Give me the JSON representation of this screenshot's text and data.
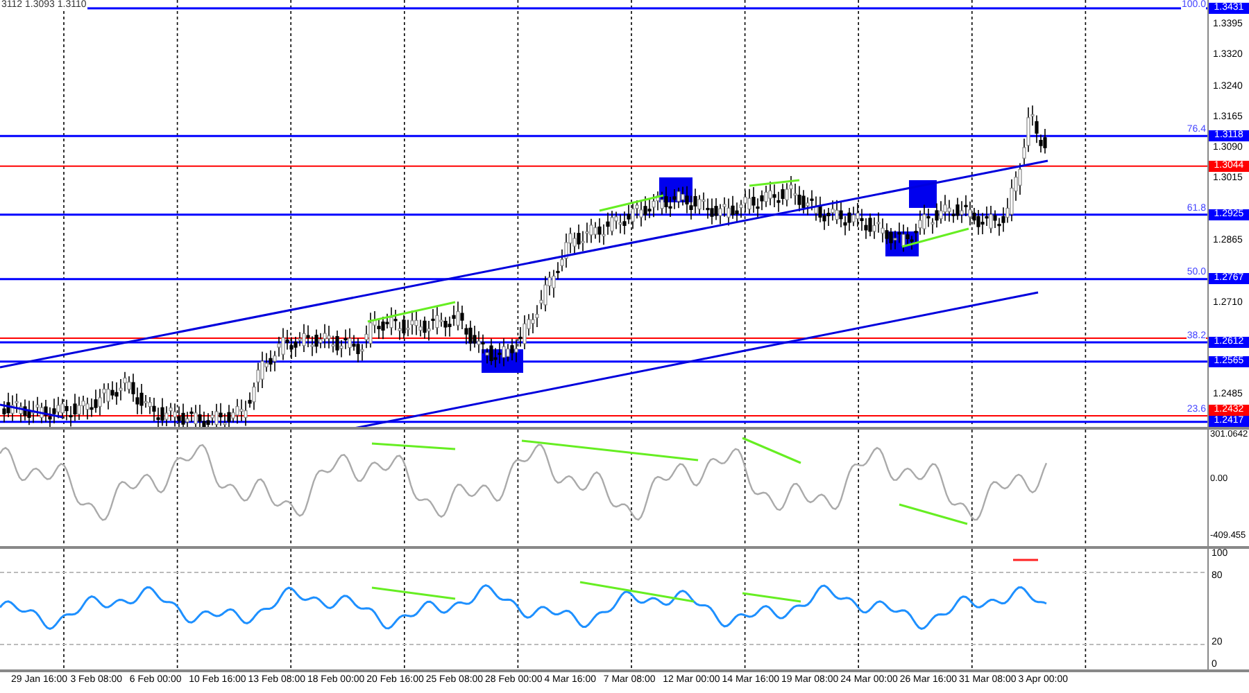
{
  "header": {
    "text": "3112 1.3093 1.3110"
  },
  "price_panel": {
    "axis_ticks": [
      "1.3395",
      "1.3320",
      "1.3240",
      "1.3165",
      "1.3090",
      "1.3015",
      "1.2865",
      "1.2710",
      "1.2485"
    ],
    "levels": [
      {
        "price": "1.3431",
        "color": "#0000ff",
        "fib": "100.0"
      },
      {
        "price": "1.3118",
        "color": "#0000ff",
        "fib": "76.4"
      },
      {
        "price": "1.3044",
        "color": "#ff0000"
      },
      {
        "price": "1.2925",
        "color": "#0000ff",
        "fib": "61.8"
      },
      {
        "price": "1.2767",
        "color": "#0000ff",
        "fib": "50.0"
      },
      {
        "price": "1.2612",
        "color": "#0000ff",
        "fib": "38.2"
      },
      {
        "price": "1.2565",
        "color": "#0000ff"
      },
      {
        "price": "1.2432",
        "color": "#ff0000",
        "fib": "23.6"
      },
      {
        "price": "1.2417",
        "color": "#0000ff"
      }
    ]
  },
  "cci_panel": {
    "axis_ticks": [
      "301.0642",
      "0.00",
      "-409.455"
    ]
  },
  "rsi_panel": {
    "axis_ticks": [
      "100",
      "80",
      "20",
      "0"
    ]
  },
  "time_axis": [
    "29 Jan 16:00",
    "3 Feb 08:00",
    "6 Feb 00:00",
    "10 Feb 16:00",
    "13 Feb 08:00",
    "18 Feb 00:00",
    "20 Feb 16:00",
    "25 Feb 08:00",
    "28 Feb 00:00",
    "4 Mar 16:00",
    "7 Mar 08:00",
    "12 Mar 00:00",
    "14 Mar 16:00",
    "19 Mar 08:00",
    "24 Mar 00:00",
    "26 Mar 16:00",
    "31 Mar 08:00",
    "3 Apr 00:00"
  ]
}
